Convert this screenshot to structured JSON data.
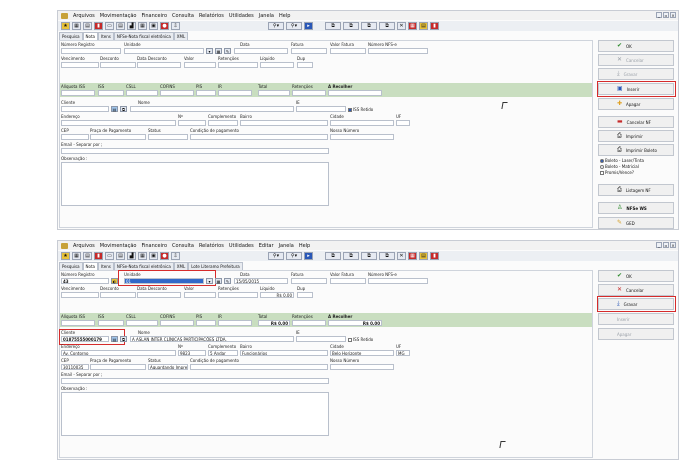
{
  "menu": [
    "Arquivos",
    "Movimentação",
    "Financeiro",
    "Consulta",
    "Relatórios",
    "Utilidades",
    "Editar",
    "Janela",
    "Help"
  ],
  "winctl": [
    "_",
    "▫",
    "×"
  ],
  "toolbar_icons": [
    "star",
    "grid",
    "doc",
    "red-doc",
    "doc2",
    "doc3",
    "chart",
    "doc4",
    "monitor",
    "car",
    "down",
    "search",
    "search2",
    "copy",
    "copy2",
    "copy3",
    "copy4",
    "tools",
    "grid2",
    "doc5",
    "red-doc2"
  ],
  "screen1": {
    "tabs": [
      "Pesquisa",
      "Nota",
      "Itens",
      "NFSe-Nota fiscal eletrônica",
      "XML"
    ],
    "labels": {
      "numero_registro": "Número Registro",
      "unidade": "Unidade",
      "data": "Data",
      "fatura": "Fatura",
      "valor_fatura": "Valor Fatura",
      "numero_nfse": "Número NFS-e",
      "vencimento": "Vencimento",
      "desconto": "Desconto",
      "data_desconto": "Data Desconto",
      "valor": "Valor",
      "retencoes": "Retenções",
      "liquido": "Líquido",
      "dup": "Dup",
      "aliquota_iss": "Alíquota ISS",
      "iss": "ISS",
      "csll": "CSLL",
      "cofins": "COFINS",
      "pis": "PIS",
      "ir": "IR",
      "total": "Total",
      "retencoes2": "Retenções",
      "a_recolher": "A Recolher",
      "cliente": "Cliente",
      "nome": "Nome",
      "ie": "IE",
      "iss_retido": "ISS Retido",
      "endereco": "Endereço",
      "nr": "Nº",
      "complemento": "Complemento",
      "bairro": "Bairro",
      "cidade": "Cidade",
      "uf": "UF",
      "cep": "CEP",
      "praca": "Praça de Pagamento",
      "status": "Status",
      "condicao": "Condição de pagamento",
      "nosso_numero": "Nosso Número",
      "email": "Email - Separar por ;",
      "observacao": "Observação :"
    },
    "side_buttons": [
      "OK",
      "Cancelar",
      "Gravar",
      "Inserir",
      "Apagar",
      "Cancelar NF",
      "Imprimir",
      "Imprimir Boleto"
    ],
    "radio_options": [
      "Boleto - Laser/Tinta",
      "Boleto - Matricial",
      "Promis/Vence?"
    ],
    "side_buttons2": [
      "Listagem NF",
      "NFSe WS",
      "GED"
    ]
  },
  "screen2": {
    "tabs": [
      "Pesquisa",
      "Nota",
      "Itens",
      "NFSe-Nota fiscal eletrônica",
      "XML",
      "Lote Literamo Prefeitura"
    ],
    "values": {
      "numero_registro": "43",
      "unidade": "01",
      "data": "15/05/2015",
      "valor_zero": "R$ 0,00",
      "total": "R$ 0,00",
      "a_recolher": "R$ 0,00",
      "cliente": "01875555000179",
      "nome": "A ASLAN INTER CLÍNICAS PARTICIPAÇÕES LTDA.",
      "endereco": "Av. Contorno",
      "numero": "9823",
      "complemento": "5 Andar",
      "bairro": "Funcionários",
      "cidade": "Belo Horizonte",
      "uf": "MG",
      "cep": "30110035",
      "status": "Aguardando Impressão"
    },
    "side_buttons": [
      "OK",
      "Cancelar",
      "Gravar",
      "Inserir",
      "Apagar"
    ]
  }
}
